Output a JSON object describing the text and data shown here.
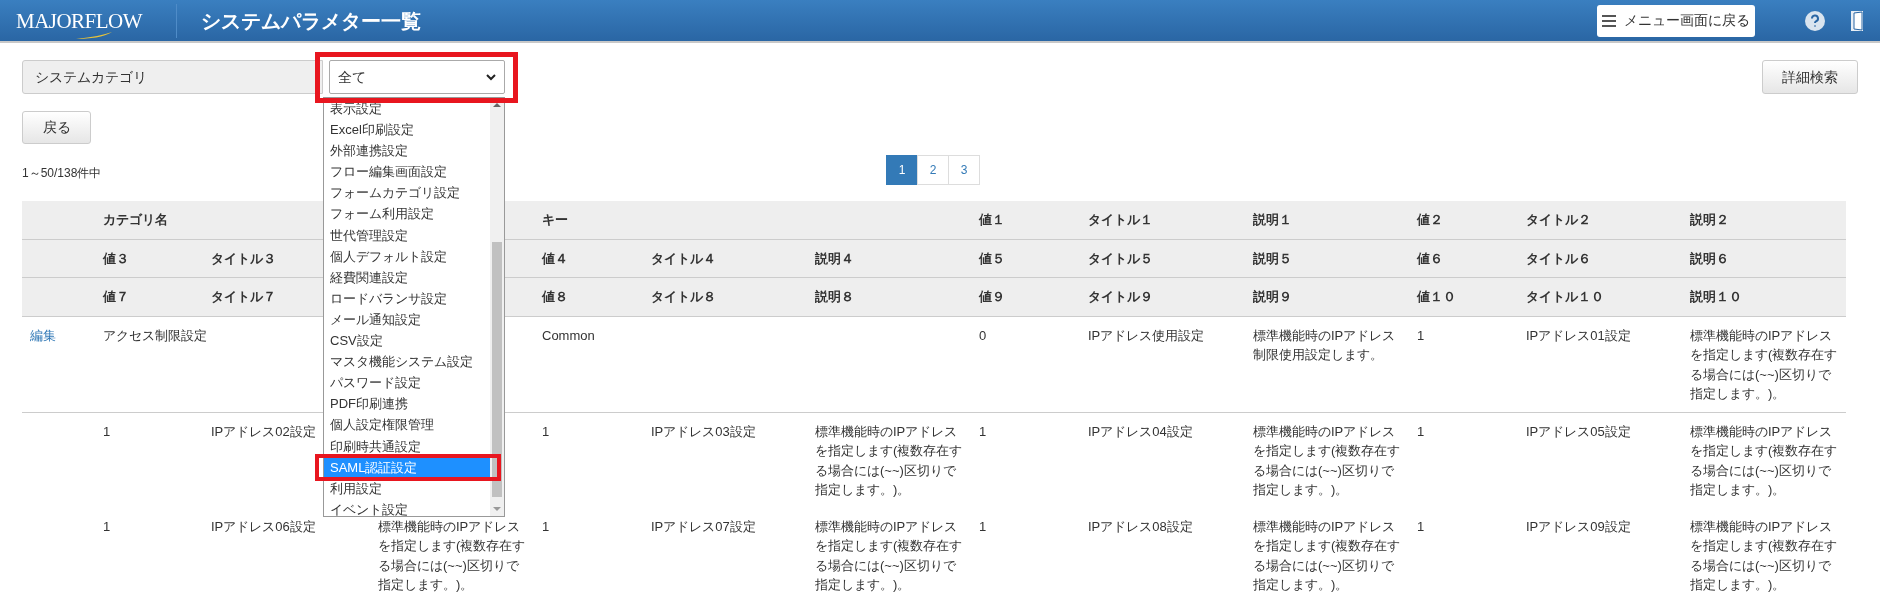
{
  "header": {
    "logo": "MAJORFLOW",
    "title": "システムパラメター一覧",
    "menu_button": "メニュー画面に戻る"
  },
  "filter": {
    "label": "システムカテゴリ",
    "select_value": "全て",
    "detail_search": "詳細検索"
  },
  "back_button": "戻る",
  "record_count": "1～50/138件中",
  "pagination": [
    {
      "label": "1",
      "selected": true
    },
    {
      "label": "2",
      "selected": false
    },
    {
      "label": "3",
      "selected": false
    }
  ],
  "table": {
    "header_rows": [
      [
        "",
        "カテゴリ名",
        "",
        "",
        "キー",
        "",
        "",
        "値１",
        "タイトル１",
        "説明１",
        "値２",
        "タイトル２",
        "説明２"
      ],
      [
        "",
        "値３",
        "タイトル３",
        "",
        "値４",
        "タイトル４",
        "説明４",
        "値５",
        "タイトル５",
        "説明５",
        "値６",
        "タイトル６",
        "説明６"
      ],
      [
        "",
        "値７",
        "タイトル７",
        "",
        "値８",
        "タイトル８",
        "説明８",
        "値９",
        "タイトル９",
        "説明９",
        "値１０",
        "タイトル１０",
        "説明１０"
      ]
    ],
    "rows": [
      [
        {
          "kind": "link",
          "text": "編集"
        },
        {
          "text": "アクセス制限設定"
        },
        {
          "text": ""
        },
        {
          "text": ""
        },
        {
          "text": "Common"
        },
        {
          "text": ""
        },
        {
          "text": ""
        },
        {
          "text": "0"
        },
        {
          "text": "IPアドレス使用設定"
        },
        {
          "text": "標準機能時のIPアドレス制限使用設定します。"
        },
        {
          "text": "1"
        },
        {
          "text": "IPアドレス01設定"
        },
        {
          "text": "標準機能時のIPアドレスを指定します(複数存在する場合には(~~)区切りで指定します。)。"
        }
      ],
      [
        {
          "text": ""
        },
        {
          "text": "1"
        },
        {
          "text": "IPアドレス02設定"
        },
        {
          "text": ""
        },
        {
          "text": "1"
        },
        {
          "text": "IPアドレス03設定"
        },
        {
          "text": "標準機能時のIPアドレスを指定します(複数存在する場合には(~~)区切りで指定します。)。"
        },
        {
          "text": "1"
        },
        {
          "text": "IPアドレス04設定"
        },
        {
          "text": "標準機能時のIPアドレスを指定します(複数存在する場合には(~~)区切りで指定します。)。"
        },
        {
          "text": "1"
        },
        {
          "text": "IPアドレス05設定"
        },
        {
          "text": "標準機能時のIPアドレスを指定します(複数存在する場合には(~~)区切りで指定します。)。"
        }
      ],
      [
        {
          "text": ""
        },
        {
          "text": "1"
        },
        {
          "text": "IPアドレス06設定"
        },
        {
          "text": "標準機能時のIPアドレスを指定します(複数存在する場合には(~~)区切りで指定します。)。"
        },
        {
          "text": "1"
        },
        {
          "text": "IPアドレス07設定"
        },
        {
          "text": "標準機能時のIPアドレスを指定します(複数存在する場合には(~~)区切りで指定します。)。"
        },
        {
          "text": "1"
        },
        {
          "text": "IPアドレス08設定"
        },
        {
          "text": "標準機能時のIPアドレスを指定します(複数存在する場合には(~~)区切りで指定します。)。"
        },
        {
          "text": "1"
        },
        {
          "text": "IPアドレス09設定"
        },
        {
          "text": "標準機能時のIPアドレスを指定します(複数存在する場合には(~~)区切りで指定します。)。"
        }
      ]
    ]
  },
  "dropdown": {
    "options": [
      {
        "label": "表示設定",
        "selected": false
      },
      {
        "label": "Excel印刷設定",
        "selected": false
      },
      {
        "label": "外部連携設定",
        "selected": false
      },
      {
        "label": "フロー編集画面設定",
        "selected": false
      },
      {
        "label": "フォームカテゴリ設定",
        "selected": false
      },
      {
        "label": "フォーム利用設定",
        "selected": false
      },
      {
        "label": "世代管理設定",
        "selected": false
      },
      {
        "label": "個人デフォルト設定",
        "selected": false
      },
      {
        "label": "経費関連設定",
        "selected": false
      },
      {
        "label": "ロードバランサ設定",
        "selected": false
      },
      {
        "label": "メール通知設定",
        "selected": false
      },
      {
        "label": "CSV設定",
        "selected": false
      },
      {
        "label": "マスタ機能システム設定",
        "selected": false
      },
      {
        "label": "パスワード設定",
        "selected": false
      },
      {
        "label": "PDF印刷連携",
        "selected": false
      },
      {
        "label": "個人設定権限管理",
        "selected": false
      },
      {
        "label": "印刷時共通設定",
        "selected": false
      },
      {
        "label": "SAML認証設定",
        "selected": true
      },
      {
        "label": "利用設定",
        "selected": false
      },
      {
        "label": "イベント設定",
        "selected": false
      }
    ]
  }
}
